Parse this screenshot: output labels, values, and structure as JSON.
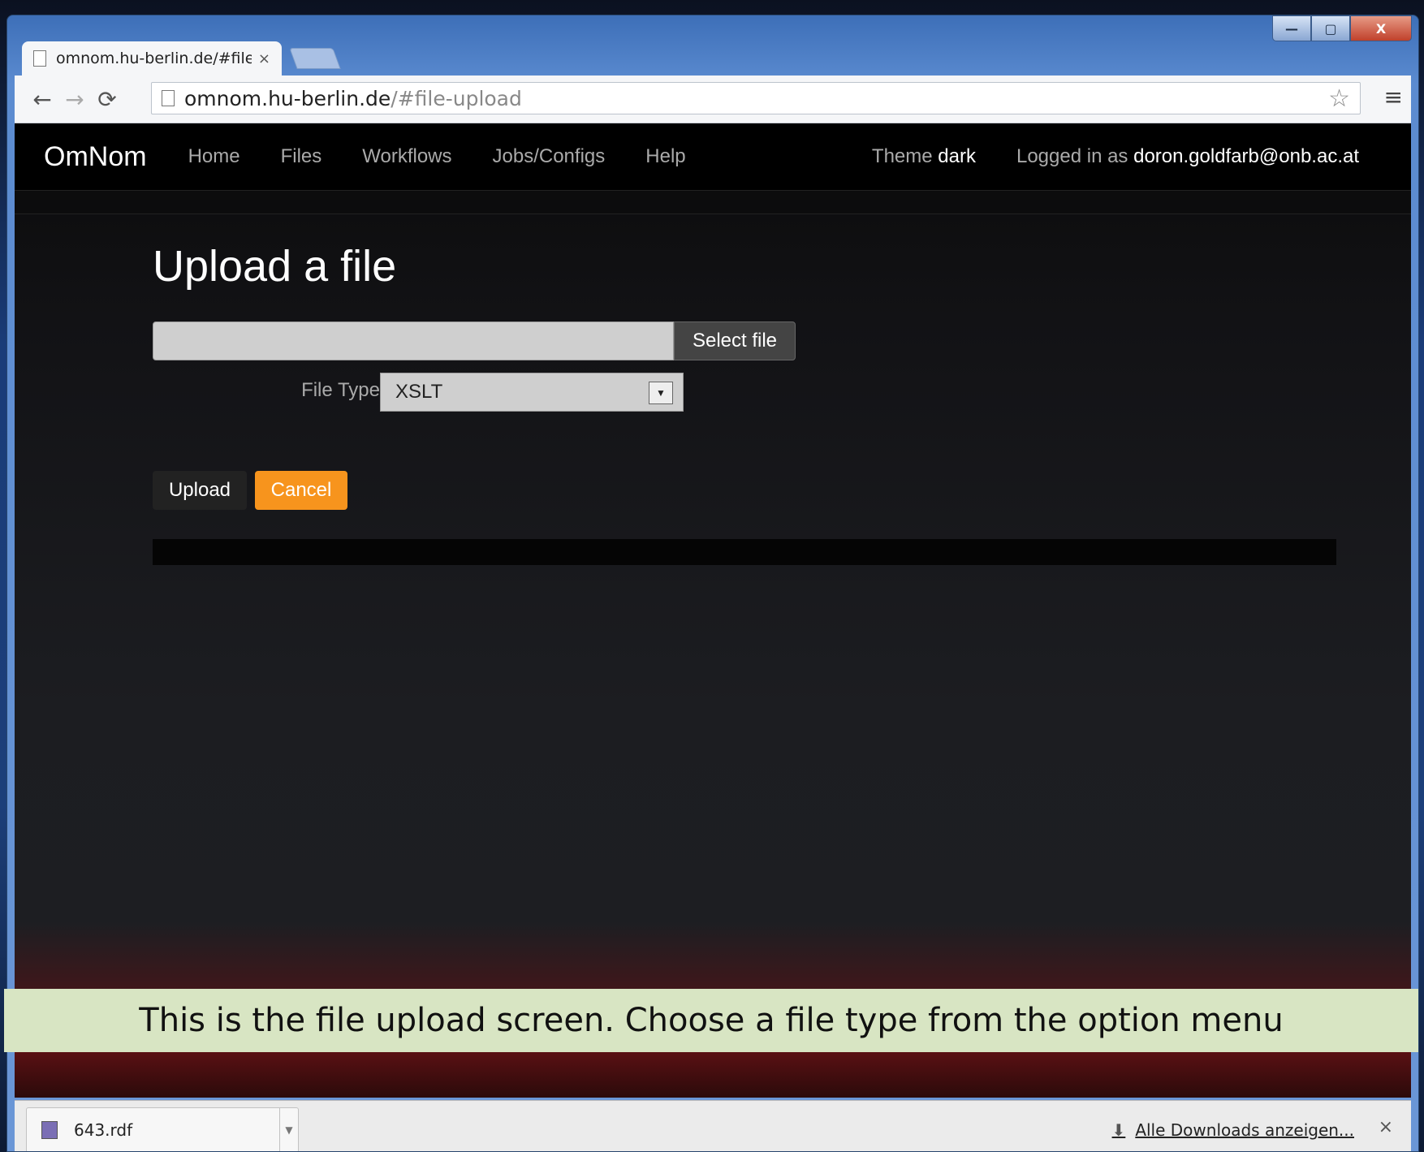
{
  "browser": {
    "tab_title": "omnom.hu-berlin.de/#file-upload",
    "tab_close": "×",
    "url_host": "omnom.hu-berlin.de",
    "url_path": "/#file-upload",
    "window_minimize": "—",
    "window_maximize": "▢",
    "window_close": "X"
  },
  "navbar": {
    "brand": "OmNom",
    "links": [
      "Home",
      "Files",
      "Workflows",
      "Jobs/Configs",
      "Help"
    ],
    "theme_label": "Theme",
    "theme_value": "dark",
    "logged_in_label": "Logged in as",
    "user": "doron.goldfarb@onb.ac.at"
  },
  "main": {
    "heading": "Upload a file",
    "file_input_value": "",
    "select_file_label": "Select file",
    "file_type_label": "File Type",
    "file_type_value": "XSLT",
    "upload_label": "Upload",
    "cancel_label": "Cancel"
  },
  "caption": "This is the file upload screen. Choose a file type from the option menu",
  "downloads": {
    "item_name": "643.rdf",
    "show_all_label": "Alle Downloads anzeigen...",
    "close": "×"
  },
  "colors": {
    "accent": "#f7941d",
    "navbar_bg": "#000000",
    "caption_bg": "#d8e5c3"
  },
  "icons": [
    "back-arrow-icon",
    "forward-arrow-icon",
    "reload-icon",
    "page-icon",
    "star-icon",
    "menu-icon",
    "dropdown-arrow-icon",
    "download-arrow-icon",
    "file-icon",
    "close-icon"
  ]
}
